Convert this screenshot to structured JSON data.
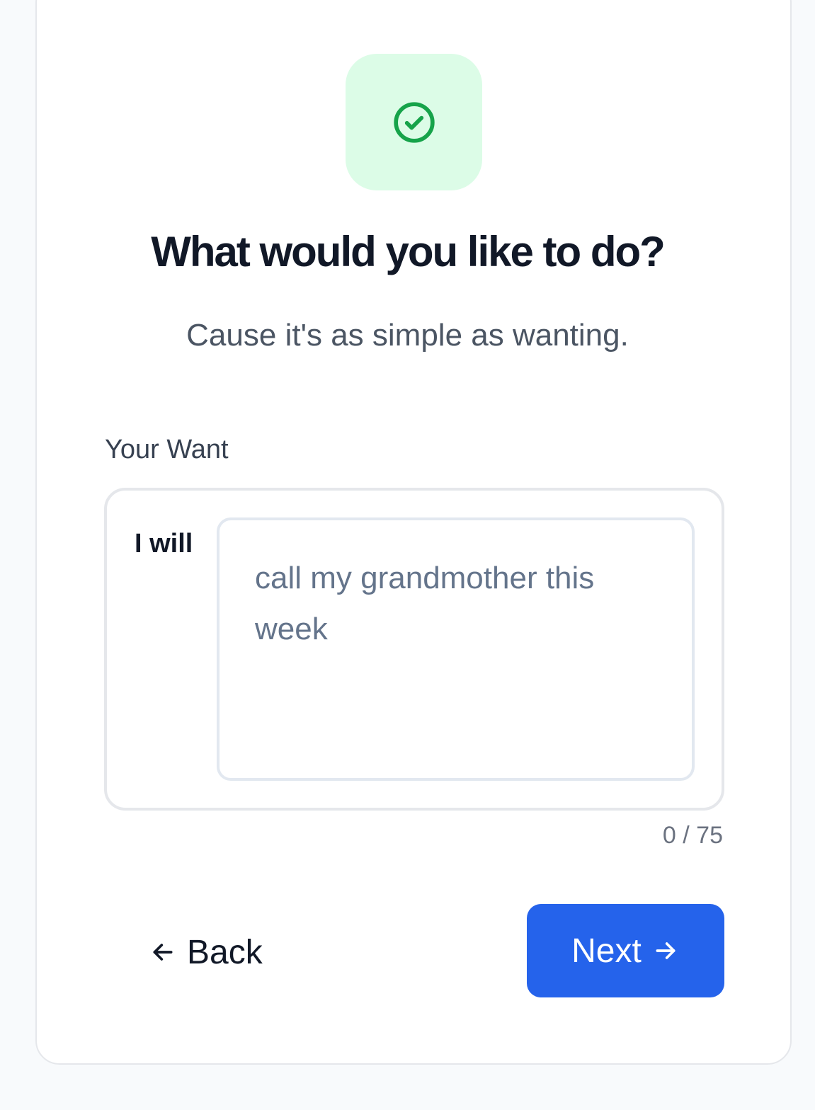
{
  "header": {
    "icon": "check-circle-icon",
    "title": "What would you like to do?",
    "subtitle": "Cause it's as simple as wanting."
  },
  "form": {
    "label": "Your Want",
    "prefix": "I will",
    "placeholder": "call my grandmother this week",
    "value": "",
    "char_count": "0 / 75"
  },
  "actions": {
    "back_label": "Back",
    "back_icon": "arrow-left-icon",
    "next_label": "Next",
    "next_icon": "arrow-right-icon"
  },
  "colors": {
    "accent": "#2563eb",
    "success": "#16a34a",
    "success_bg": "#dcfce7"
  }
}
